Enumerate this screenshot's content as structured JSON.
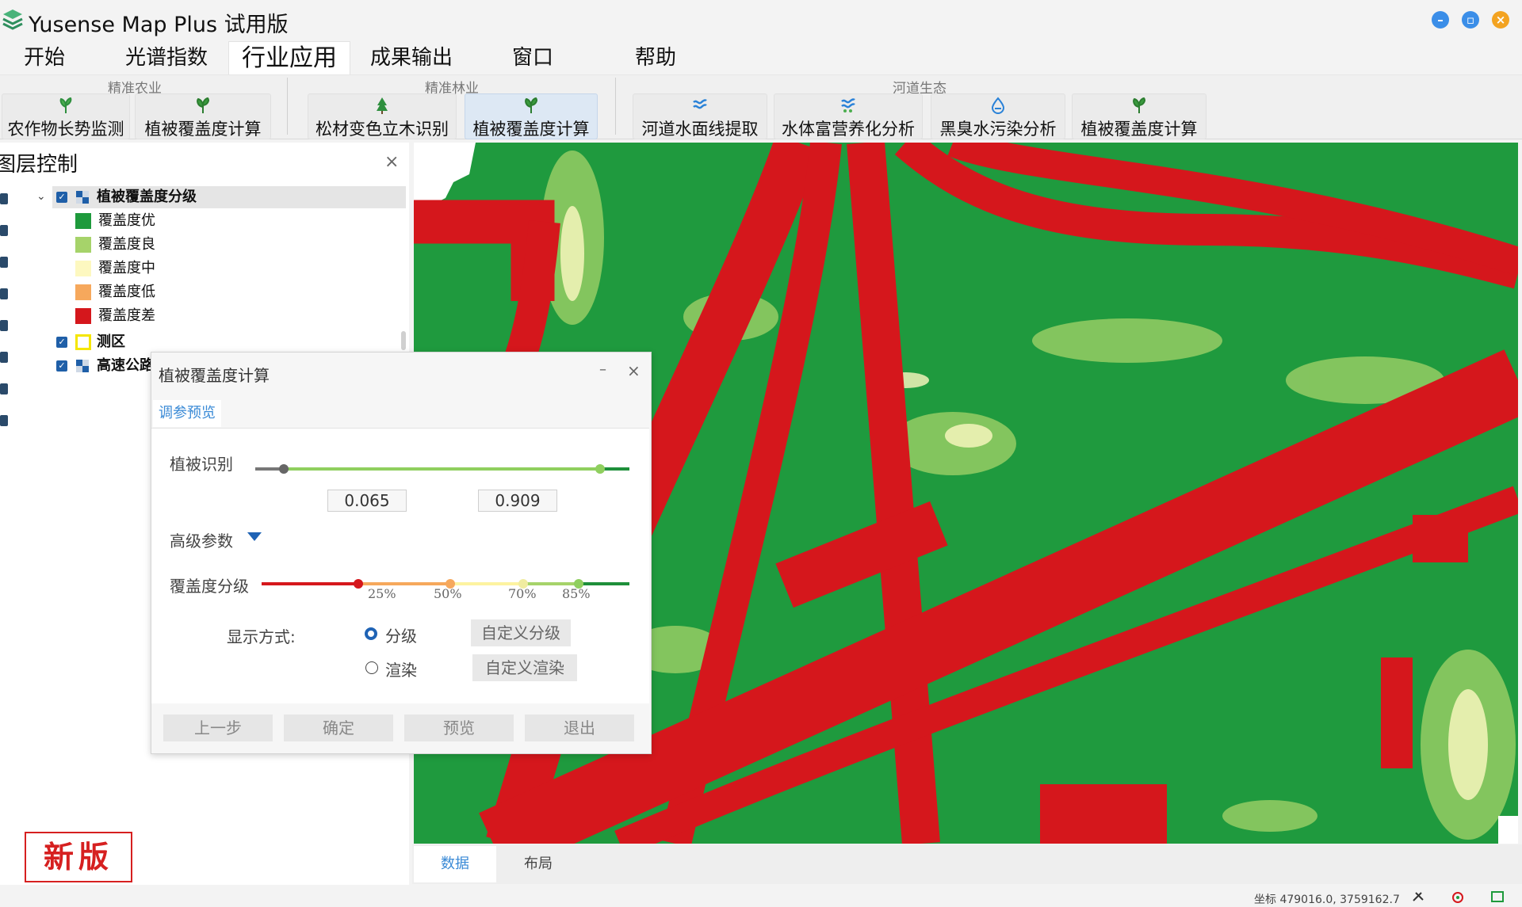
{
  "app": {
    "title": "Yusense Map Plus 试用版"
  },
  "menu": {
    "tabs": [
      "开始",
      "光谱指数",
      "行业应用",
      "成果输出",
      "窗口",
      "帮助"
    ],
    "active": "行业应用"
  },
  "ribbon": {
    "groups": [
      {
        "label": "精准农业",
        "items": [
          "农作物长势监测",
          "植被覆盖度计算"
        ]
      },
      {
        "label": "精准林业",
        "items": [
          "松材变色立木识别",
          "植被覆盖度计算"
        ]
      },
      {
        "label": "河道生态",
        "items": [
          "河道水面线提取",
          "水体富营养化分析",
          "黑臭水污染分析",
          "植被覆盖度计算"
        ]
      }
    ]
  },
  "layer_panel": {
    "title": "图层控制",
    "layers": [
      {
        "name": "植被覆盖度分级",
        "checked": true
      },
      {
        "name": "测区",
        "checked": true
      },
      {
        "name": "高速公路",
        "checked": true
      }
    ],
    "legend": [
      {
        "label": "覆盖度优",
        "color": "#1e9a3c"
      },
      {
        "label": "覆盖度良",
        "color": "#a6d36a"
      },
      {
        "label": "覆盖度中",
        "color": "#fdf8c0"
      },
      {
        "label": "覆盖度低",
        "color": "#f6a85c"
      },
      {
        "label": "覆盖度差",
        "color": "#d5171c"
      }
    ],
    "stamp": "新版"
  },
  "dialog": {
    "title": "植被覆盖度计算",
    "tab": "调参预览",
    "veg_id_label": "植被识别",
    "veg_min": "0.065",
    "veg_max": "0.909",
    "advanced_label": "高级参数",
    "grading_label": "覆盖度分级",
    "grading_ticks": [
      "25%",
      "50%",
      "70%",
      "85%"
    ],
    "display_label": "显示方式:",
    "opt_graded": "分级",
    "opt_render": "渲染",
    "btn_custom_grade": "自定义分级",
    "btn_custom_render": "自定义渲染",
    "btn_prev": "上一步",
    "btn_ok": "确定",
    "btn_preview": "预览",
    "btn_exit": "退出"
  },
  "map_tabs": {
    "data": "数据",
    "layout": "布局"
  },
  "status": {
    "coord": "坐标 479016.0, 3759162.7"
  },
  "colors": {
    "excellent": "#1e9a3c",
    "poor": "#d5171c",
    "good": "#a6d36a",
    "accent": "#1f63b5"
  }
}
